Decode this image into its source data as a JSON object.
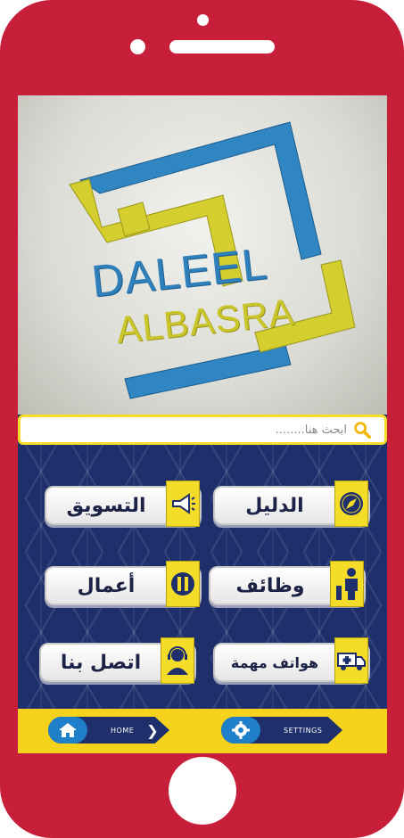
{
  "logo": {
    "line1": "DALEEL",
    "line2": "ALBASRA"
  },
  "search": {
    "placeholder": "ابحث هنا........"
  },
  "menu": {
    "guide": "الدليل",
    "marketing": "التسويق",
    "jobs": "وظائف",
    "business": "أعمال",
    "phones": "هواتف مهمة",
    "contact": "اتصل بنا"
  },
  "bottom_nav": {
    "home_label": "HOME",
    "settings_label": "SETTINGS"
  },
  "icons": {
    "guide": "compass-icon",
    "marketing": "megaphone-icon",
    "jobs": "person-level-icon",
    "business": "tools-icon",
    "phones": "ambulance-icon",
    "contact": "support-agent-icon",
    "search": "search-icon",
    "home": "home-icon",
    "settings": "gear-icon"
  },
  "colors": {
    "frame": "#c71e3a",
    "navy": "#1f2f6b",
    "yellow": "#f5dc29",
    "blue": "#1f80c9"
  }
}
